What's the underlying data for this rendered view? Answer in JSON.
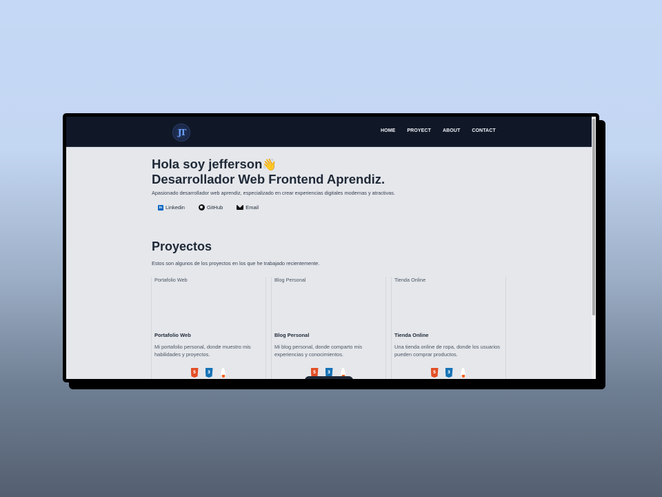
{
  "nav": {
    "logo_text": "JT",
    "links": [
      "HOME",
      "PROYECT",
      "ABOUT",
      "CONTACT"
    ]
  },
  "hero": {
    "title_line1": "Hola soy jefferson",
    "wave_emoji": "👋",
    "title_line2": "Desarrollador Web Frontend Aprendiz.",
    "subtitle": "Apasionado desarrollador web aprendiz, especializado en crear experiencias digitales modernas y atractivas.",
    "socials": [
      {
        "label": "Linkedin",
        "icon": "linkedin-icon"
      },
      {
        "label": "GitHub",
        "icon": "github-icon"
      },
      {
        "label": "Email",
        "icon": "mail-icon"
      }
    ]
  },
  "projects": {
    "title": "Proyectos",
    "subtitle": "Estos son algunos de los proyectos en los que he trabajado recientemente.",
    "cards": [
      {
        "img_alt": "Portafolio Web",
        "title": "Portafolio Web",
        "description": "Mi portafolio personal, donde muestro mis habilidades y proyectos.",
        "tech_icons": [
          "html5-icon",
          "css3-icon",
          "astro-icon"
        ]
      },
      {
        "img_alt": "Blog Personal",
        "title": "Blog Personal",
        "description": "Mi blog personal, donde comparto mis experiencias y conocimientos.",
        "tech_icons": [
          "html5-icon",
          "css3-icon",
          "astro-icon"
        ]
      },
      {
        "img_alt": "Tienda Online",
        "title": "Tienda Online",
        "description": "Una tienda online de ropa, donde los usuarios pueden comprar productos.",
        "tech_icons": [
          "html5-icon",
          "css3-icon",
          "astro-icon"
        ]
      }
    ]
  },
  "colors": {
    "navbar_bg": "#101828",
    "page_bg": "#e5e7eb",
    "text_dark": "#1f2937",
    "html5": "#e34f26",
    "css3": "#1572b6",
    "astro_flame": "#ff5d01"
  }
}
